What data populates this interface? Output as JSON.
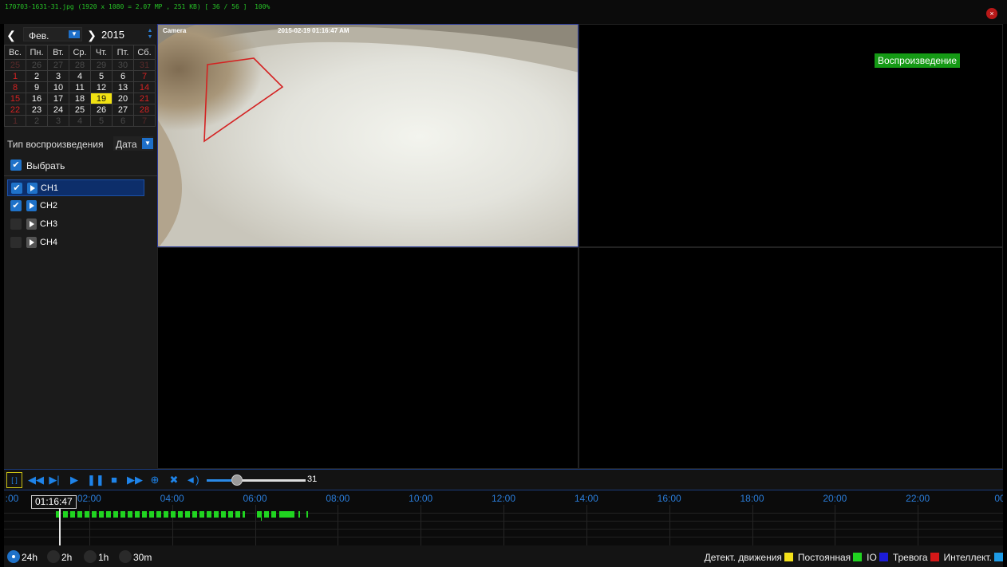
{
  "viewer": {
    "title": "170703-1631-31.jpg (1920 x 1080 = 2.07 MP , 251 KB) [ 36 / 56 ]  100%",
    "close": "×"
  },
  "calendar": {
    "month": "Фев.",
    "year": "2015",
    "weekdays": [
      "Вс.",
      "Пн.",
      "Вт.",
      "Ср.",
      "Чт.",
      "Пт.",
      "Сб."
    ],
    "weeks": [
      [
        "25",
        "26",
        "27",
        "28",
        "29",
        "30",
        "31"
      ],
      [
        "1",
        "2",
        "3",
        "4",
        "5",
        "6",
        "7"
      ],
      [
        "8",
        "9",
        "10",
        "11",
        "12",
        "13",
        "14"
      ],
      [
        "15",
        "16",
        "17",
        "18",
        "19",
        "20",
        "21"
      ],
      [
        "22",
        "23",
        "24",
        "25",
        "26",
        "27",
        "28"
      ],
      [
        "1",
        "2",
        "3",
        "4",
        "5",
        "6",
        "7"
      ]
    ],
    "outside_rows": [
      0,
      5
    ],
    "selected_day": "19"
  },
  "playback_type": {
    "label": "Тип воспроизведения",
    "value": "Дата"
  },
  "select_all": {
    "label": "Выбрать",
    "checked": true
  },
  "channels": [
    {
      "label": "CH1",
      "checked": true,
      "active": true
    },
    {
      "label": "CH2",
      "checked": true,
      "active": false
    },
    {
      "label": "CH3",
      "checked": false,
      "active": false
    },
    {
      "label": "CH4",
      "checked": false,
      "active": false
    }
  ],
  "camera": {
    "name": "Camera",
    "timestamp": "2015-02-19 01:16:47 AM"
  },
  "playback_badge": "Воспроизведение",
  "toolbar": {
    "volume": "31",
    "volume_level": 0.31
  },
  "timeline": {
    "labels": [
      ":00",
      "02:00",
      "04:00",
      "06:00",
      "08:00",
      "10:00",
      "12:00",
      "14:00",
      "16:00",
      "18:00",
      "20:00",
      "22:00",
      "00"
    ],
    "cursor_time": "01:16:47"
  },
  "time_ranges": [
    {
      "label": "24h",
      "selected": true
    },
    {
      "label": "2h",
      "selected": false
    },
    {
      "label": "1h",
      "selected": false
    },
    {
      "label": "30m",
      "selected": false
    }
  ],
  "legend": [
    {
      "label": "Детект. движения",
      "color": "#f3e11a"
    },
    {
      "label": "Постоянная",
      "color": "#20d420"
    },
    {
      "label": "IO",
      "color": "#1c1cd8"
    },
    {
      "label": "Тревога",
      "color": "#d41818"
    },
    {
      "label": "Интеллект.",
      "color": "#1e9be6"
    }
  ],
  "colors": {
    "accent": "#1f72c9",
    "record_continuous": "#20d420",
    "selected_day": "#f1e212",
    "badge": "#159a15"
  }
}
